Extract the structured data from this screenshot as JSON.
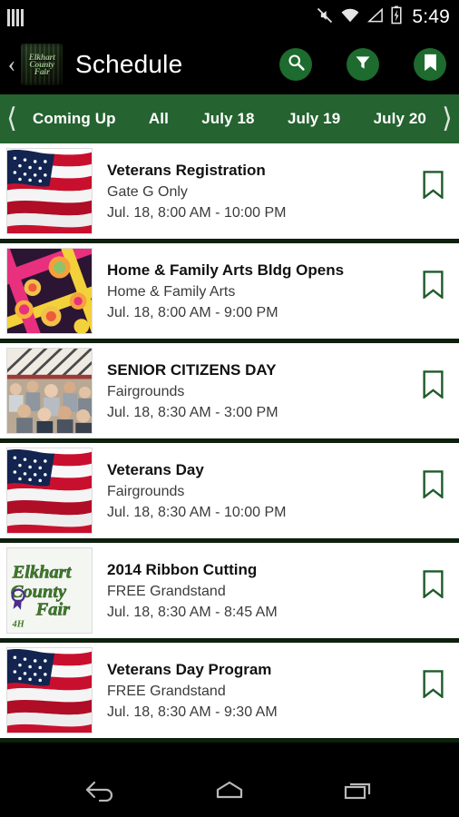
{
  "status_bar": {
    "time": "5:49",
    "icons": [
      "notification-bars-icon",
      "mute-icon",
      "wifi-icon",
      "signal-icon",
      "battery-charging-icon"
    ]
  },
  "header": {
    "back_label": "‹",
    "logo_line1": "Elkhart",
    "logo_line2": "County",
    "logo_line3": "Fair",
    "title": "Schedule",
    "actions": [
      {
        "name": "search-button",
        "icon": "search-icon"
      },
      {
        "name": "filter-button",
        "icon": "funnel-icon"
      },
      {
        "name": "bookmarks-button",
        "icon": "bookmark-icon"
      }
    ]
  },
  "tabs": {
    "left_arrow": "⟨",
    "right_arrow": "⟩",
    "items": [
      {
        "label": "Coming Up",
        "selected": true
      },
      {
        "label": "All",
        "selected": false
      },
      {
        "label": "July 18",
        "selected": false
      },
      {
        "label": "July 19",
        "selected": false
      },
      {
        "label": "July 20",
        "selected": false
      }
    ]
  },
  "events": [
    {
      "title": "Veterans Registration",
      "location": "Gate G Only",
      "time": "Jul. 18, 8:00 AM - 10:00 PM",
      "thumbnail": "us-flag"
    },
    {
      "title": "Home & Family Arts Bldg Opens",
      "location": "Home & Family Arts",
      "time": "Jul. 18, 8:00 AM - 9:00 PM",
      "thumbnail": "quilt"
    },
    {
      "title": "SENIOR CITIZENS DAY",
      "location": "Fairgrounds",
      "time": "Jul. 18, 8:30 AM - 3:00 PM",
      "thumbnail": "crowd-tent"
    },
    {
      "title": "Veterans Day",
      "location": "Fairgrounds",
      "time": "Jul. 18, 8:30 AM - 10:00 PM",
      "thumbnail": "us-flag"
    },
    {
      "title": "2014 Ribbon Cutting",
      "location": "FREE Grandstand",
      "time": "Jul. 18, 8:30 AM - 8:45 AM",
      "thumbnail": "fair-logo"
    },
    {
      "title": "Veterans Day Program",
      "location": "FREE Grandstand",
      "time": "Jul. 18, 8:30 AM - 9:30 AM",
      "thumbnail": "us-flag"
    }
  ],
  "nav_bar": {
    "buttons": [
      {
        "name": "android-back-button",
        "icon": "back-arrow-icon"
      },
      {
        "name": "android-home-button",
        "icon": "home-icon"
      },
      {
        "name": "android-recents-button",
        "icon": "recents-icon"
      }
    ]
  },
  "colors": {
    "brand_green": "#256330",
    "icon_green": "#1d6b2e",
    "bookmark_outline": "#1d5c2a",
    "divider": "#0d1f0d"
  }
}
